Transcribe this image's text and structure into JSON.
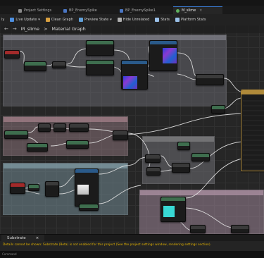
{
  "tabs": [
    {
      "label": "Project Settings",
      "icon": "settings-icon",
      "active": false
    },
    {
      "label": "BP_EnemySpike",
      "icon": "blueprint-icon",
      "active": false
    },
    {
      "label": "BP_EnemySpike1",
      "icon": "blueprint-icon",
      "active": false
    },
    {
      "label": "M_slime",
      "icon": "material-icon",
      "active": true
    }
  ],
  "toolbar": {
    "first": "ly",
    "live_update": "Live Update",
    "clean_graph": "Clean Graph",
    "preview_state": "Preview State",
    "hide_unrelated": "Hide Unrelated",
    "stats": "Stats",
    "platform_stats": "Platform Stats"
  },
  "breadcrumb": {
    "back": "←",
    "forward": "→",
    "root": "M_slime",
    "separator": ">",
    "current": "Material Graph"
  },
  "bottom": {
    "tab_label": "Substrate",
    "tab_close": "×",
    "message": "Details cannot be shown: Substrate (Beta) is not enabled for this project (See the project settings window, rendering settings section).",
    "footer": "Command"
  },
  "colors": {
    "accent": "#3a7bd5",
    "warning": "#e0b000",
    "result_node": "#b08a3a"
  }
}
